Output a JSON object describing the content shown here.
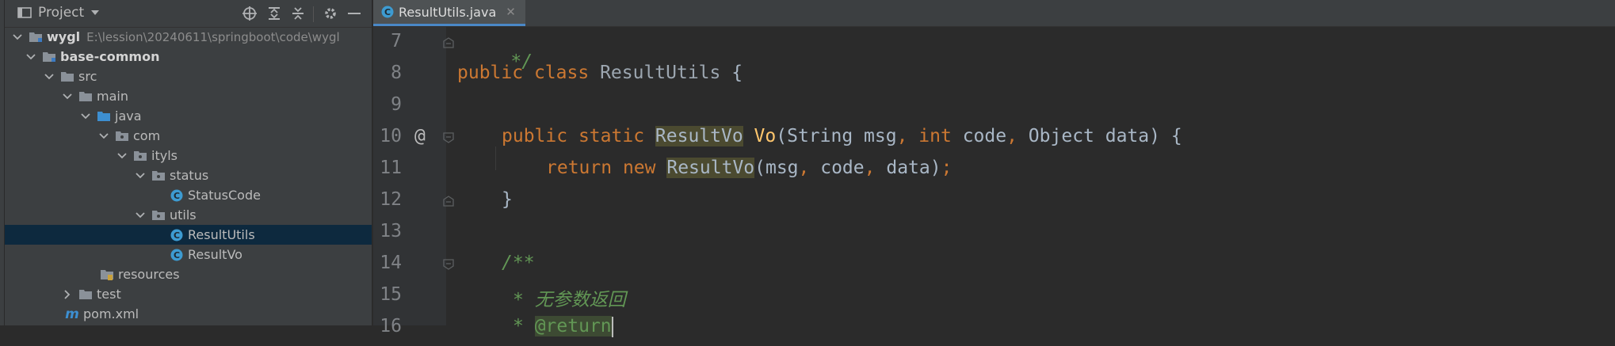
{
  "project_panel": {
    "title": "Project",
    "tree": [
      {
        "label": "wygl",
        "path": "E:\\lession\\20240611\\springboot\\code\\wygl",
        "depth": 0,
        "expanded": true,
        "icon": "module-folder-icon"
      },
      {
        "label": "base-common",
        "depth": 1,
        "expanded": true,
        "icon": "module-folder-icon"
      },
      {
        "label": "src",
        "depth": 2,
        "expanded": true,
        "icon": "folder-icon"
      },
      {
        "label": "main",
        "depth": 3,
        "expanded": true,
        "icon": "folder-icon"
      },
      {
        "label": "java",
        "depth": 4,
        "expanded": true,
        "icon": "source-folder-icon"
      },
      {
        "label": "com",
        "depth": 5,
        "expanded": true,
        "icon": "package-icon"
      },
      {
        "label": "ityls",
        "depth": 6,
        "expanded": true,
        "icon": "package-icon"
      },
      {
        "label": "status",
        "depth": 7,
        "expanded": true,
        "icon": "package-icon"
      },
      {
        "label": "StatusCode",
        "depth": 8,
        "icon": "class-icon"
      },
      {
        "label": "utils",
        "depth": 7,
        "expanded": true,
        "icon": "package-icon"
      },
      {
        "label": "ResultUtils",
        "depth": 8,
        "icon": "class-icon",
        "selected": true
      },
      {
        "label": "ResultVo",
        "depth": 8,
        "icon": "class-icon"
      },
      {
        "label": "resources",
        "depth": 4,
        "icon": "resources-folder-icon"
      },
      {
        "label": "test",
        "depth": 3,
        "expanded": false,
        "icon": "folder-icon"
      },
      {
        "label": "pom.xml",
        "depth": 2,
        "icon": "maven-icon"
      }
    ]
  },
  "editor": {
    "tab": {
      "label": "ResultUtils.java"
    },
    "line_numbers": [
      "7",
      "8",
      "9",
      "10",
      "11",
      "12",
      "13",
      "14",
      "15",
      "16"
    ],
    "code": {
      "l7": "*/",
      "l8_kw1": "public",
      "l8_kw2": "class",
      "l8_cls": "ResultUtils",
      "l8_rest": " {",
      "l10_kw1": "public",
      "l10_kw2": "static",
      "l10_type": "ResultVo",
      "l10_fn": "Vo",
      "l10_p1": "(String msg",
      "l10_comma1": ",",
      "l10_int": "int",
      "l10_p2": " code",
      "l10_comma2": ",",
      "l10_p3": " Object data) {",
      "l11_kw1": "return",
      "l11_kw2": "new",
      "l11_type": "ResultVo",
      "l11_p1": "(msg",
      "l11_comma1": ",",
      "l11_p2": " code",
      "l11_comma2": ",",
      "l11_p3": " data)",
      "l11_semi": ";",
      "l12": "}",
      "l14": "/**",
      "l15_star": "* ",
      "l15_text": "无参数返回",
      "l16_star": "* ",
      "l16_tag": "@return"
    }
  }
}
